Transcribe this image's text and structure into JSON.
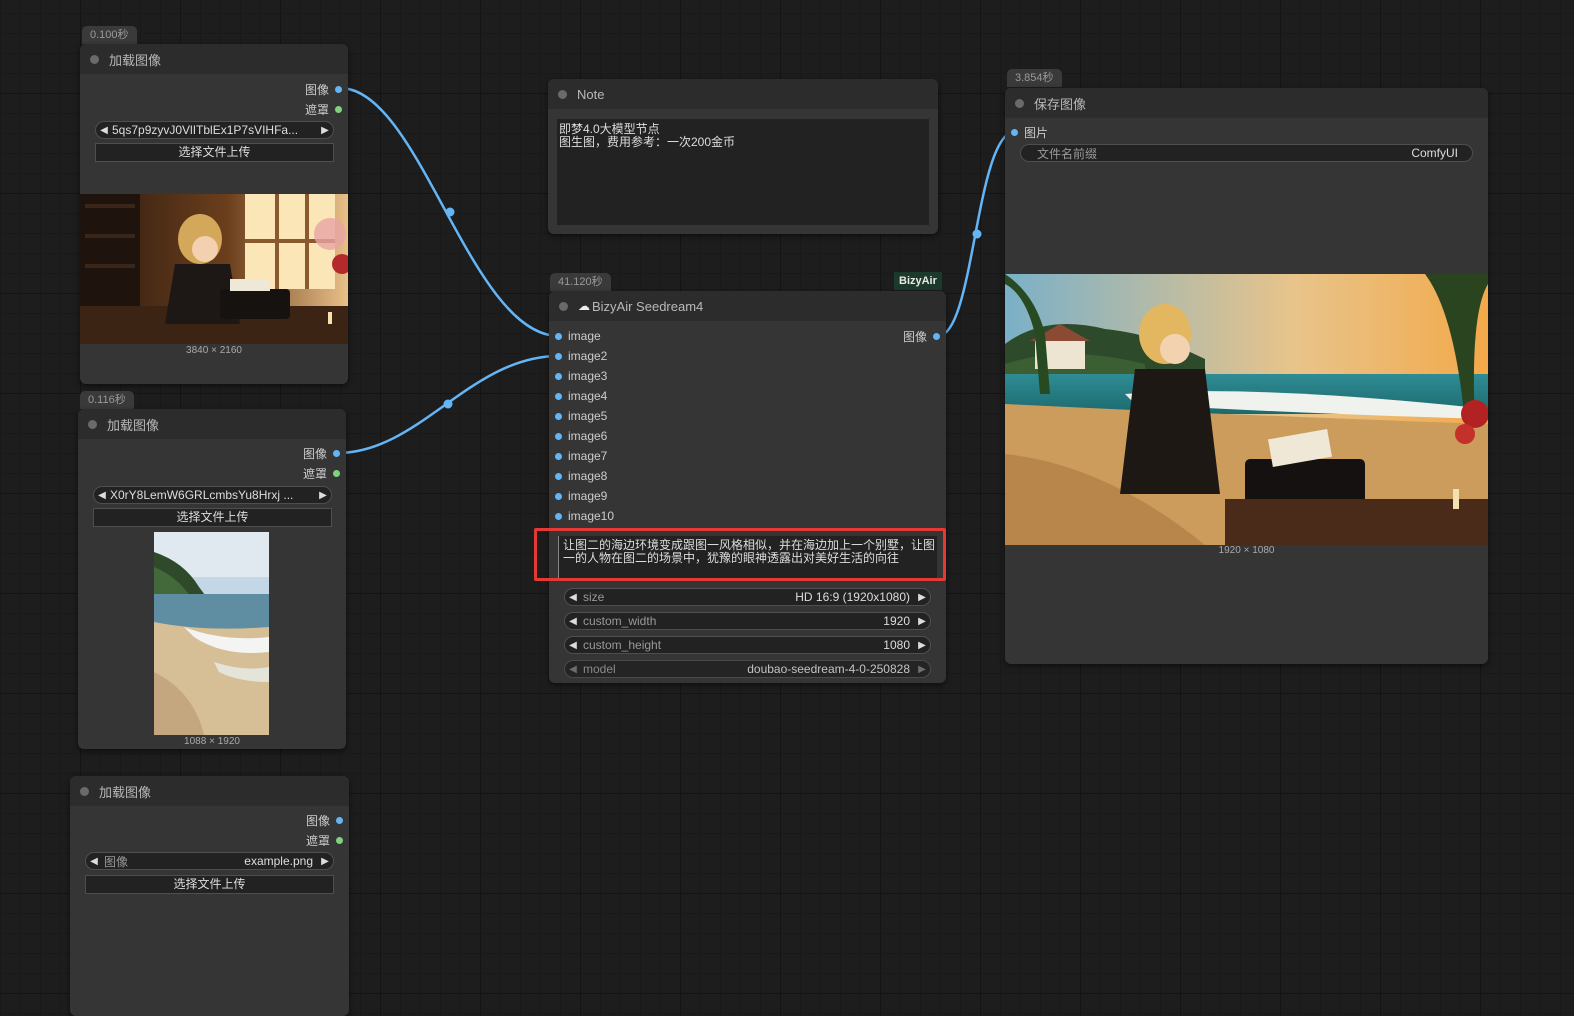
{
  "nodes": {
    "load1": {
      "timing": "0.100秒",
      "title": "加载图像",
      "outputs": [
        "图像",
        "遮罩"
      ],
      "file": "5qs7p9zyvJ0VlITblEx1P7sVIHFa...",
      "upload_label": "选择文件上传",
      "dims": "3840 × 2160"
    },
    "load2": {
      "timing": "0.116秒",
      "title": "加载图像",
      "outputs": [
        "图像",
        "遮罩"
      ],
      "file": "X0rY8LemW6GRLcmbsYu8Hrxj ...",
      "upload_label": "选择文件上传",
      "dims": "1088 × 1920"
    },
    "load3": {
      "title": "加载图像",
      "outputs": [
        "图像",
        "遮罩"
      ],
      "widget_label": "图像",
      "file": "example.png",
      "upload_label": "选择文件上传"
    },
    "note": {
      "title": "Note",
      "text": "即梦4.0大模型节点\n图生图，费用参考：一次200金币"
    },
    "seedream": {
      "timing": "41.120秒",
      "brand": "BizyAir",
      "title": "BizyAir Seedream4",
      "inputs": [
        "image",
        "image2",
        "image3",
        "image4",
        "image5",
        "image6",
        "image7",
        "image8",
        "image9",
        "image10"
      ],
      "output": "图像",
      "prompt": "让图二的海边环境变成跟图一风格相似，并在海边加上一个别墅，让图一的人物在图二的场景中，犹豫的眼神透露出对美好生活的向往",
      "widgets": [
        {
          "label": "size",
          "value": "HD 16:9 (1920x1080)"
        },
        {
          "label": "custom_width",
          "value": "1920"
        },
        {
          "label": "custom_height",
          "value": "1080"
        },
        {
          "label": "model",
          "value": "doubao-seedream-4-0-250828"
        }
      ]
    },
    "save": {
      "timing": "3.854秒",
      "title": "保存图像",
      "input": "图片",
      "prefix_label": "文件名前缀",
      "prefix_value": "ComfyUI",
      "dims": "1920 × 1080"
    }
  },
  "colors": {
    "image_port": "#64b5f6",
    "mask_port": "#7ed37e",
    "highlight": "#e53935",
    "link": "#64b5f6"
  }
}
